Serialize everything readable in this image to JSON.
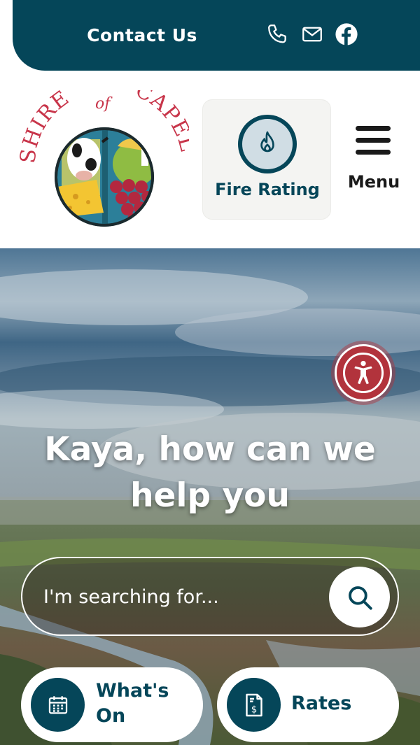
{
  "colors": {
    "brand_teal": "#054659",
    "accent_red": "#b2333c",
    "light_tile": "#f4f4f2",
    "white": "#ffffff"
  },
  "topbar": {
    "contact_label": "Contact Us",
    "icons": [
      "phone-icon",
      "mail-icon",
      "facebook-icon"
    ]
  },
  "header": {
    "logo": {
      "text_top": "SHIRE",
      "text_of": "of",
      "text_right": "CAPEL"
    },
    "fire_rating": {
      "label": "Fire Rating",
      "icon": "flame-icon"
    },
    "menu": {
      "label": "Menu",
      "icon": "hamburger-icon"
    }
  },
  "hero": {
    "accessibility_icon": "accessibility-icon",
    "title_line1": "Kaya, how can we",
    "title_line2": "help you",
    "search": {
      "placeholder": "I'm searching for...",
      "value": "",
      "icon": "search-icon"
    },
    "quick_links": [
      {
        "label_line1": "What's",
        "label_line2": "On",
        "icon": "calendar-icon"
      },
      {
        "label": "Rates",
        "icon": "invoice-dollar-icon"
      }
    ]
  }
}
